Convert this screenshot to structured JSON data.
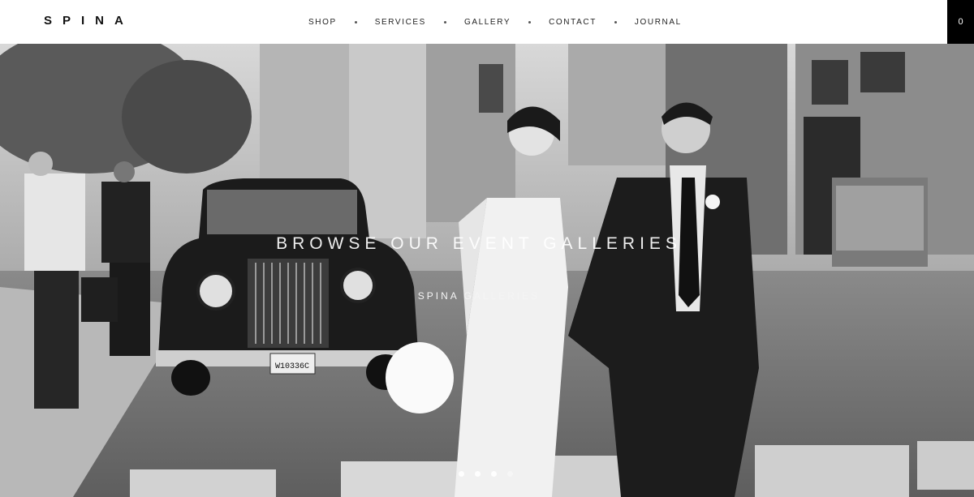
{
  "header": {
    "logo": "SPINA",
    "nav": [
      {
        "label": "SHOP"
      },
      {
        "label": "SERVICES"
      },
      {
        "label": "GALLERY"
      },
      {
        "label": "CONTACT"
      },
      {
        "label": "JOURNAL"
      }
    ],
    "cart_count": "0"
  },
  "hero": {
    "title": "BROWSE OUR EVENT GALLERIES",
    "subtitle": "SPINA GALLERIES",
    "license_plate": "W10336C",
    "slides": [
      {
        "active": true
      },
      {
        "active": true
      },
      {
        "active": true
      },
      {
        "active": false
      }
    ]
  }
}
